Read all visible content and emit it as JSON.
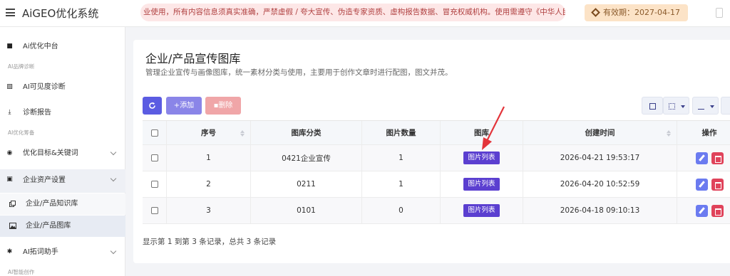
{
  "app": {
    "brand": "AiGEO优化系统"
  },
  "topbar": {
    "notice": "业使用，所有内容信息须真实准确，严禁虚假 / 夸大宣传、伪造专家资质、虚构报告数据、冒充权威机构。使用需遵守《中华人民共和",
    "expiry": "有效期：2027-04-17"
  },
  "sidebar": {
    "home": "Ai优化中台",
    "cap1": "AI品牌诊断",
    "visibility": "AI可见度诊断",
    "report": "诊断报告",
    "cap2": "AI优化筹备",
    "target": "优化目标&关键词",
    "assets": "企业资产设置",
    "knowledge": "企业/产品知识库",
    "gallery": "企业/产品图库",
    "keyword": "AI拓词助手",
    "cap3": "AI智能创作"
  },
  "page": {
    "title": "企业/产品宣传图库",
    "desc": "管理企业宣传与画像图库，统一素材分类与使用，主要用于创作文章时进行配图，图文并茂。"
  },
  "toolbar": {
    "add_label": "添加",
    "delete_label": "删除"
  },
  "table": {
    "headers": [
      "序号",
      "图库分类",
      "图片数量",
      "图库",
      "创建时间",
      "操作"
    ],
    "rows": [
      {
        "no": "1",
        "category": "0421企业宣传",
        "count": "1",
        "gallery": "图片列表",
        "created": "2026-04-21 19:53:17"
      },
      {
        "no": "2",
        "category": "0211",
        "count": "1",
        "gallery": "图片列表",
        "created": "2026-04-20 10:52:59"
      },
      {
        "no": "3",
        "category": "0101",
        "count": "0",
        "gallery": "图片列表",
        "created": "2026-04-18 09:10:13"
      }
    ]
  },
  "footer": "显示第 1 到第 3 条记录，总共 3 条记录",
  "colors": {
    "primary": "#5b5ce2",
    "gallery_button": "#5b3fd0",
    "delete": "#e0435b",
    "annotation_arrow": "#e3343a"
  }
}
